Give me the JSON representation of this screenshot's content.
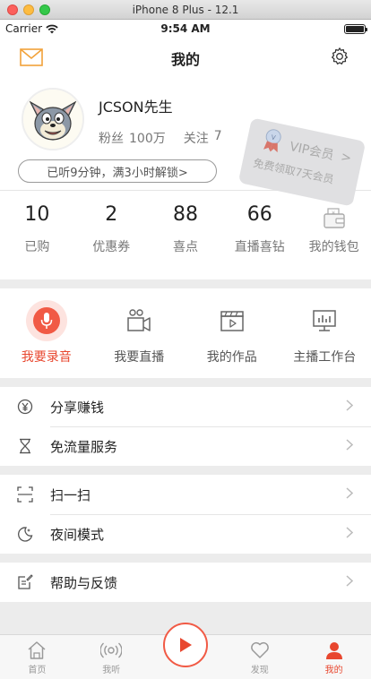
{
  "simulator": {
    "title": "iPhone 8 Plus - 12.1"
  },
  "status": {
    "carrier": "Carrier",
    "time": "9:54 AM"
  },
  "nav": {
    "title": "我的"
  },
  "profile": {
    "username": "JCSON先生",
    "fans_label": "粉丝",
    "fans_value": "100万",
    "follow_label": "关注",
    "follow_value": "7",
    "listen_text": "已听9分钟，满3小时解锁>"
  },
  "vip": {
    "title": "VIP会员",
    "arrow": ">",
    "subtitle": "免费领取7天会员"
  },
  "counts": [
    {
      "value": "10",
      "label": "已购"
    },
    {
      "value": "2",
      "label": "优惠券"
    },
    {
      "value": "88",
      "label": "喜点"
    },
    {
      "value": "66",
      "label": "直播喜钻"
    },
    {
      "value": "",
      "label": "我的钱包"
    }
  ],
  "features": [
    {
      "label": "我要录音"
    },
    {
      "label": "我要直播"
    },
    {
      "label": "我的作品"
    },
    {
      "label": "主播工作台"
    }
  ],
  "menu": {
    "share": "分享赚钱",
    "traffic": "免流量服务",
    "scan": "扫一扫",
    "night": "夜间模式",
    "help": "帮助与反馈"
  },
  "tabs": [
    {
      "label": "首页"
    },
    {
      "label": "我听"
    },
    {
      "label": "发现"
    },
    {
      "label": "我的"
    }
  ],
  "colors": {
    "accent": "#f15a45",
    "accent_text": "#e8472f",
    "background": "#ececec"
  }
}
